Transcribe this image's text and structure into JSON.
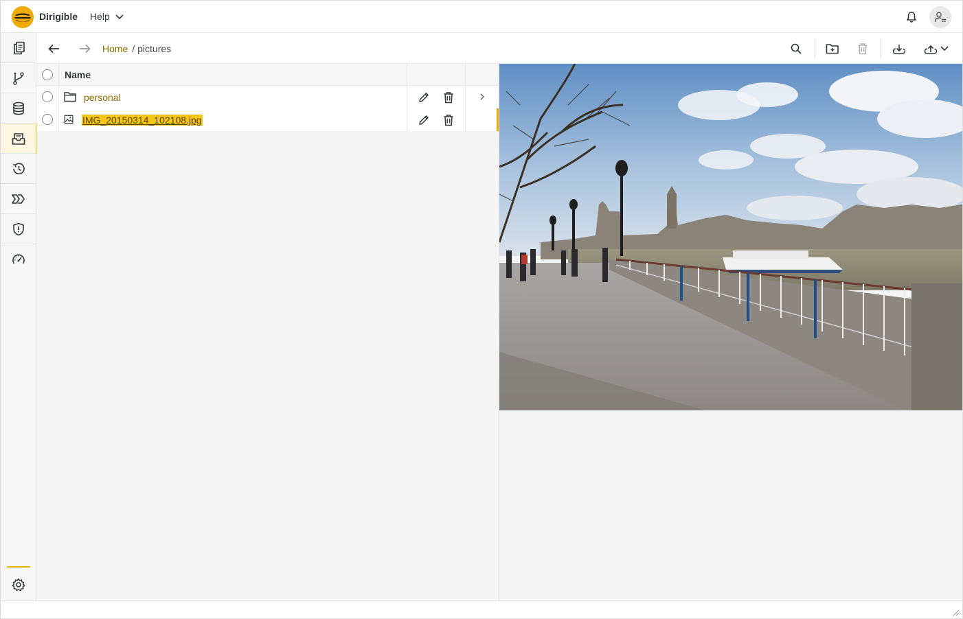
{
  "app": {
    "title": "Dirigible",
    "help_label": "Help",
    "brand_color": "#f0ab00"
  },
  "header": {
    "notifications_icon": "bell-icon",
    "user_icon": "user-settings-icon"
  },
  "sidebar": {
    "items": [
      {
        "name": "projects",
        "icon": "documents-icon",
        "active": false
      },
      {
        "name": "git",
        "icon": "git-branch-icon",
        "active": false
      },
      {
        "name": "database",
        "icon": "database-icon",
        "active": false
      },
      {
        "name": "documents",
        "icon": "inbox-tray-icon",
        "active": true
      },
      {
        "name": "history",
        "icon": "history-icon",
        "active": false
      },
      {
        "name": "processes",
        "icon": "chevrons-icon",
        "active": false
      },
      {
        "name": "security",
        "icon": "shield-icon",
        "active": false
      },
      {
        "name": "monitoring",
        "icon": "gauge-icon",
        "active": false
      }
    ],
    "settings_icon": "gear-icon"
  },
  "toolbar": {
    "breadcrumb": {
      "home": "Home",
      "current": "/ pictures"
    }
  },
  "table": {
    "columns": [
      "Name"
    ],
    "rows": [
      {
        "type": "folder",
        "name": "personal",
        "selected": false,
        "has_chevron": true
      },
      {
        "type": "image",
        "name": "IMG_20150314_102108.jpg",
        "selected": true,
        "has_chevron": false
      }
    ]
  }
}
